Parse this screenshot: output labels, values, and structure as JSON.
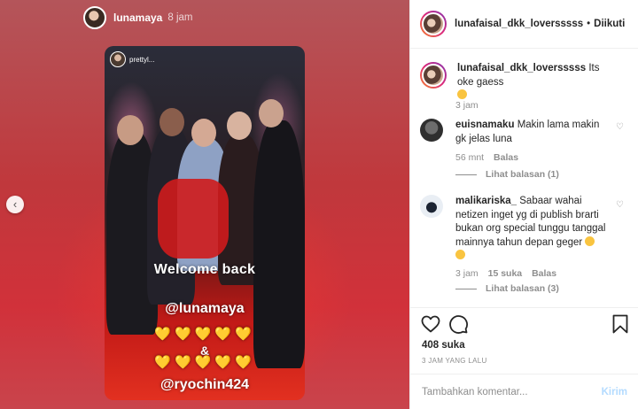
{
  "story": {
    "username": "lunamaya",
    "time": "8 jam",
    "inner_username": "prettyl...",
    "overlay": {
      "welcome": "Welcome back",
      "mention1": "@lunamaya",
      "hearts": "💛💛💛💛💛",
      "amp": "&",
      "mention2": "@ryochin424"
    }
  },
  "post": {
    "username": "lunafaisal_dkk_loversssss",
    "dot": "•",
    "follow_label": "Diikuti"
  },
  "caption": {
    "username": "lunafaisal_dkk_loversssss",
    "text": "Its oke gaess",
    "time": "3 jam"
  },
  "comments": [
    {
      "username": "euisnamaku",
      "text": "Makin lama makin gk jelas luna",
      "time": "56 mnt",
      "reply_label": "Balas",
      "view_replies": "Lihat balasan (1)"
    },
    {
      "username": "malikariska_",
      "text": "Sabaar wahai netizen inget yg di publish brarti bukan org special tunggu tanggal mainnya tahun depan geger",
      "time": "3 jam",
      "likes": "15 suka",
      "reply_label": "Balas",
      "view_replies": "Lihat balasan (3)"
    }
  ],
  "likes_count": "408 suka",
  "posted_ago": "3 JAM YANG LALU",
  "comment_box": {
    "placeholder": "Tambahkan komentar...",
    "post_label": "Kirim"
  },
  "colors": {
    "accent_disabled": "#b3dbff",
    "muted": "#8e8e8e",
    "heart_yellow": "#ffd83b"
  },
  "icons": [
    "chevron-left-icon",
    "heart-icon",
    "comment-icon",
    "bookmark-icon"
  ]
}
